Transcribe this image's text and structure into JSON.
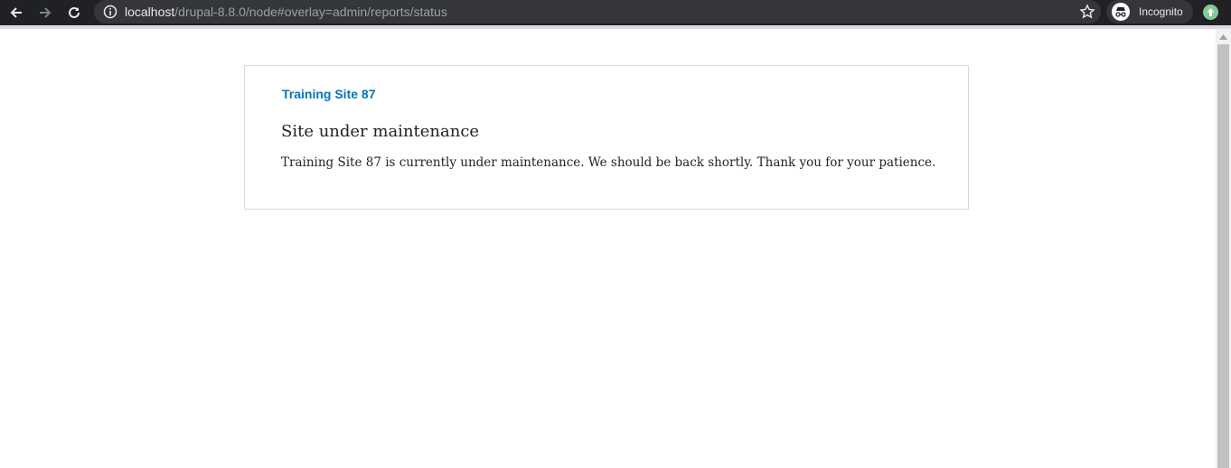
{
  "browser": {
    "url_host": "localhost",
    "url_path": "/drupal-8.8.0/node#overlay=admin/reports/status",
    "incognito_label": "Incognito",
    "icons": [
      "back-arrow-icon",
      "forward-arrow-icon",
      "reload-icon",
      "info-icon",
      "star-icon",
      "incognito-icon",
      "update-icon"
    ],
    "colors": {
      "toolbar_bg": "#202124",
      "omnibox_bg": "#35363a",
      "update_badge": "#81c995"
    }
  },
  "page": {
    "site_name": "Training Site 87",
    "title": "Site under maintenance",
    "message": "Training Site 87 is currently under maintenance. We should be back shortly. Thank you for your patience.",
    "colors": {
      "site_name": "#0074bd",
      "card_border": "#d8d8d8"
    }
  }
}
